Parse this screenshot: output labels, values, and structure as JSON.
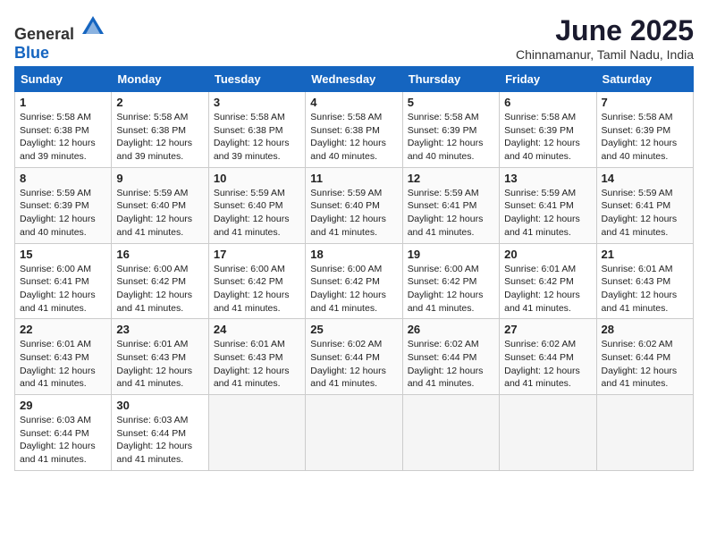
{
  "header": {
    "logo_general": "General",
    "logo_blue": "Blue",
    "month": "June 2025",
    "location": "Chinnamanur, Tamil Nadu, India"
  },
  "weekdays": [
    "Sunday",
    "Monday",
    "Tuesday",
    "Wednesday",
    "Thursday",
    "Friday",
    "Saturday"
  ],
  "weeks": [
    [
      {
        "day": 1,
        "sunrise": "5:58 AM",
        "sunset": "6:38 PM",
        "daylight": "12 hours and 39 minutes"
      },
      {
        "day": 2,
        "sunrise": "5:58 AM",
        "sunset": "6:38 PM",
        "daylight": "12 hours and 39 minutes"
      },
      {
        "day": 3,
        "sunrise": "5:58 AM",
        "sunset": "6:38 PM",
        "daylight": "12 hours and 39 minutes"
      },
      {
        "day": 4,
        "sunrise": "5:58 AM",
        "sunset": "6:38 PM",
        "daylight": "12 hours and 40 minutes"
      },
      {
        "day": 5,
        "sunrise": "5:58 AM",
        "sunset": "6:39 PM",
        "daylight": "12 hours and 40 minutes"
      },
      {
        "day": 6,
        "sunrise": "5:58 AM",
        "sunset": "6:39 PM",
        "daylight": "12 hours and 40 minutes"
      },
      {
        "day": 7,
        "sunrise": "5:58 AM",
        "sunset": "6:39 PM",
        "daylight": "12 hours and 40 minutes"
      }
    ],
    [
      {
        "day": 8,
        "sunrise": "5:59 AM",
        "sunset": "6:39 PM",
        "daylight": "12 hours and 40 minutes"
      },
      {
        "day": 9,
        "sunrise": "5:59 AM",
        "sunset": "6:40 PM",
        "daylight": "12 hours and 41 minutes"
      },
      {
        "day": 10,
        "sunrise": "5:59 AM",
        "sunset": "6:40 PM",
        "daylight": "12 hours and 41 minutes"
      },
      {
        "day": 11,
        "sunrise": "5:59 AM",
        "sunset": "6:40 PM",
        "daylight": "12 hours and 41 minutes"
      },
      {
        "day": 12,
        "sunrise": "5:59 AM",
        "sunset": "6:41 PM",
        "daylight": "12 hours and 41 minutes"
      },
      {
        "day": 13,
        "sunrise": "5:59 AM",
        "sunset": "6:41 PM",
        "daylight": "12 hours and 41 minutes"
      },
      {
        "day": 14,
        "sunrise": "5:59 AM",
        "sunset": "6:41 PM",
        "daylight": "12 hours and 41 minutes"
      }
    ],
    [
      {
        "day": 15,
        "sunrise": "6:00 AM",
        "sunset": "6:41 PM",
        "daylight": "12 hours and 41 minutes"
      },
      {
        "day": 16,
        "sunrise": "6:00 AM",
        "sunset": "6:42 PM",
        "daylight": "12 hours and 41 minutes"
      },
      {
        "day": 17,
        "sunrise": "6:00 AM",
        "sunset": "6:42 PM",
        "daylight": "12 hours and 41 minutes"
      },
      {
        "day": 18,
        "sunrise": "6:00 AM",
        "sunset": "6:42 PM",
        "daylight": "12 hours and 41 minutes"
      },
      {
        "day": 19,
        "sunrise": "6:00 AM",
        "sunset": "6:42 PM",
        "daylight": "12 hours and 41 minutes"
      },
      {
        "day": 20,
        "sunrise": "6:01 AM",
        "sunset": "6:42 PM",
        "daylight": "12 hours and 41 minutes"
      },
      {
        "day": 21,
        "sunrise": "6:01 AM",
        "sunset": "6:43 PM",
        "daylight": "12 hours and 41 minutes"
      }
    ],
    [
      {
        "day": 22,
        "sunrise": "6:01 AM",
        "sunset": "6:43 PM",
        "daylight": "12 hours and 41 minutes"
      },
      {
        "day": 23,
        "sunrise": "6:01 AM",
        "sunset": "6:43 PM",
        "daylight": "12 hours and 41 minutes"
      },
      {
        "day": 24,
        "sunrise": "6:01 AM",
        "sunset": "6:43 PM",
        "daylight": "12 hours and 41 minutes"
      },
      {
        "day": 25,
        "sunrise": "6:02 AM",
        "sunset": "6:44 PM",
        "daylight": "12 hours and 41 minutes"
      },
      {
        "day": 26,
        "sunrise": "6:02 AM",
        "sunset": "6:44 PM",
        "daylight": "12 hours and 41 minutes"
      },
      {
        "day": 27,
        "sunrise": "6:02 AM",
        "sunset": "6:44 PM",
        "daylight": "12 hours and 41 minutes"
      },
      {
        "day": 28,
        "sunrise": "6:02 AM",
        "sunset": "6:44 PM",
        "daylight": "12 hours and 41 minutes"
      }
    ],
    [
      {
        "day": 29,
        "sunrise": "6:03 AM",
        "sunset": "6:44 PM",
        "daylight": "12 hours and 41 minutes"
      },
      {
        "day": 30,
        "sunrise": "6:03 AM",
        "sunset": "6:44 PM",
        "daylight": "12 hours and 41 minutes"
      },
      null,
      null,
      null,
      null,
      null
    ]
  ]
}
